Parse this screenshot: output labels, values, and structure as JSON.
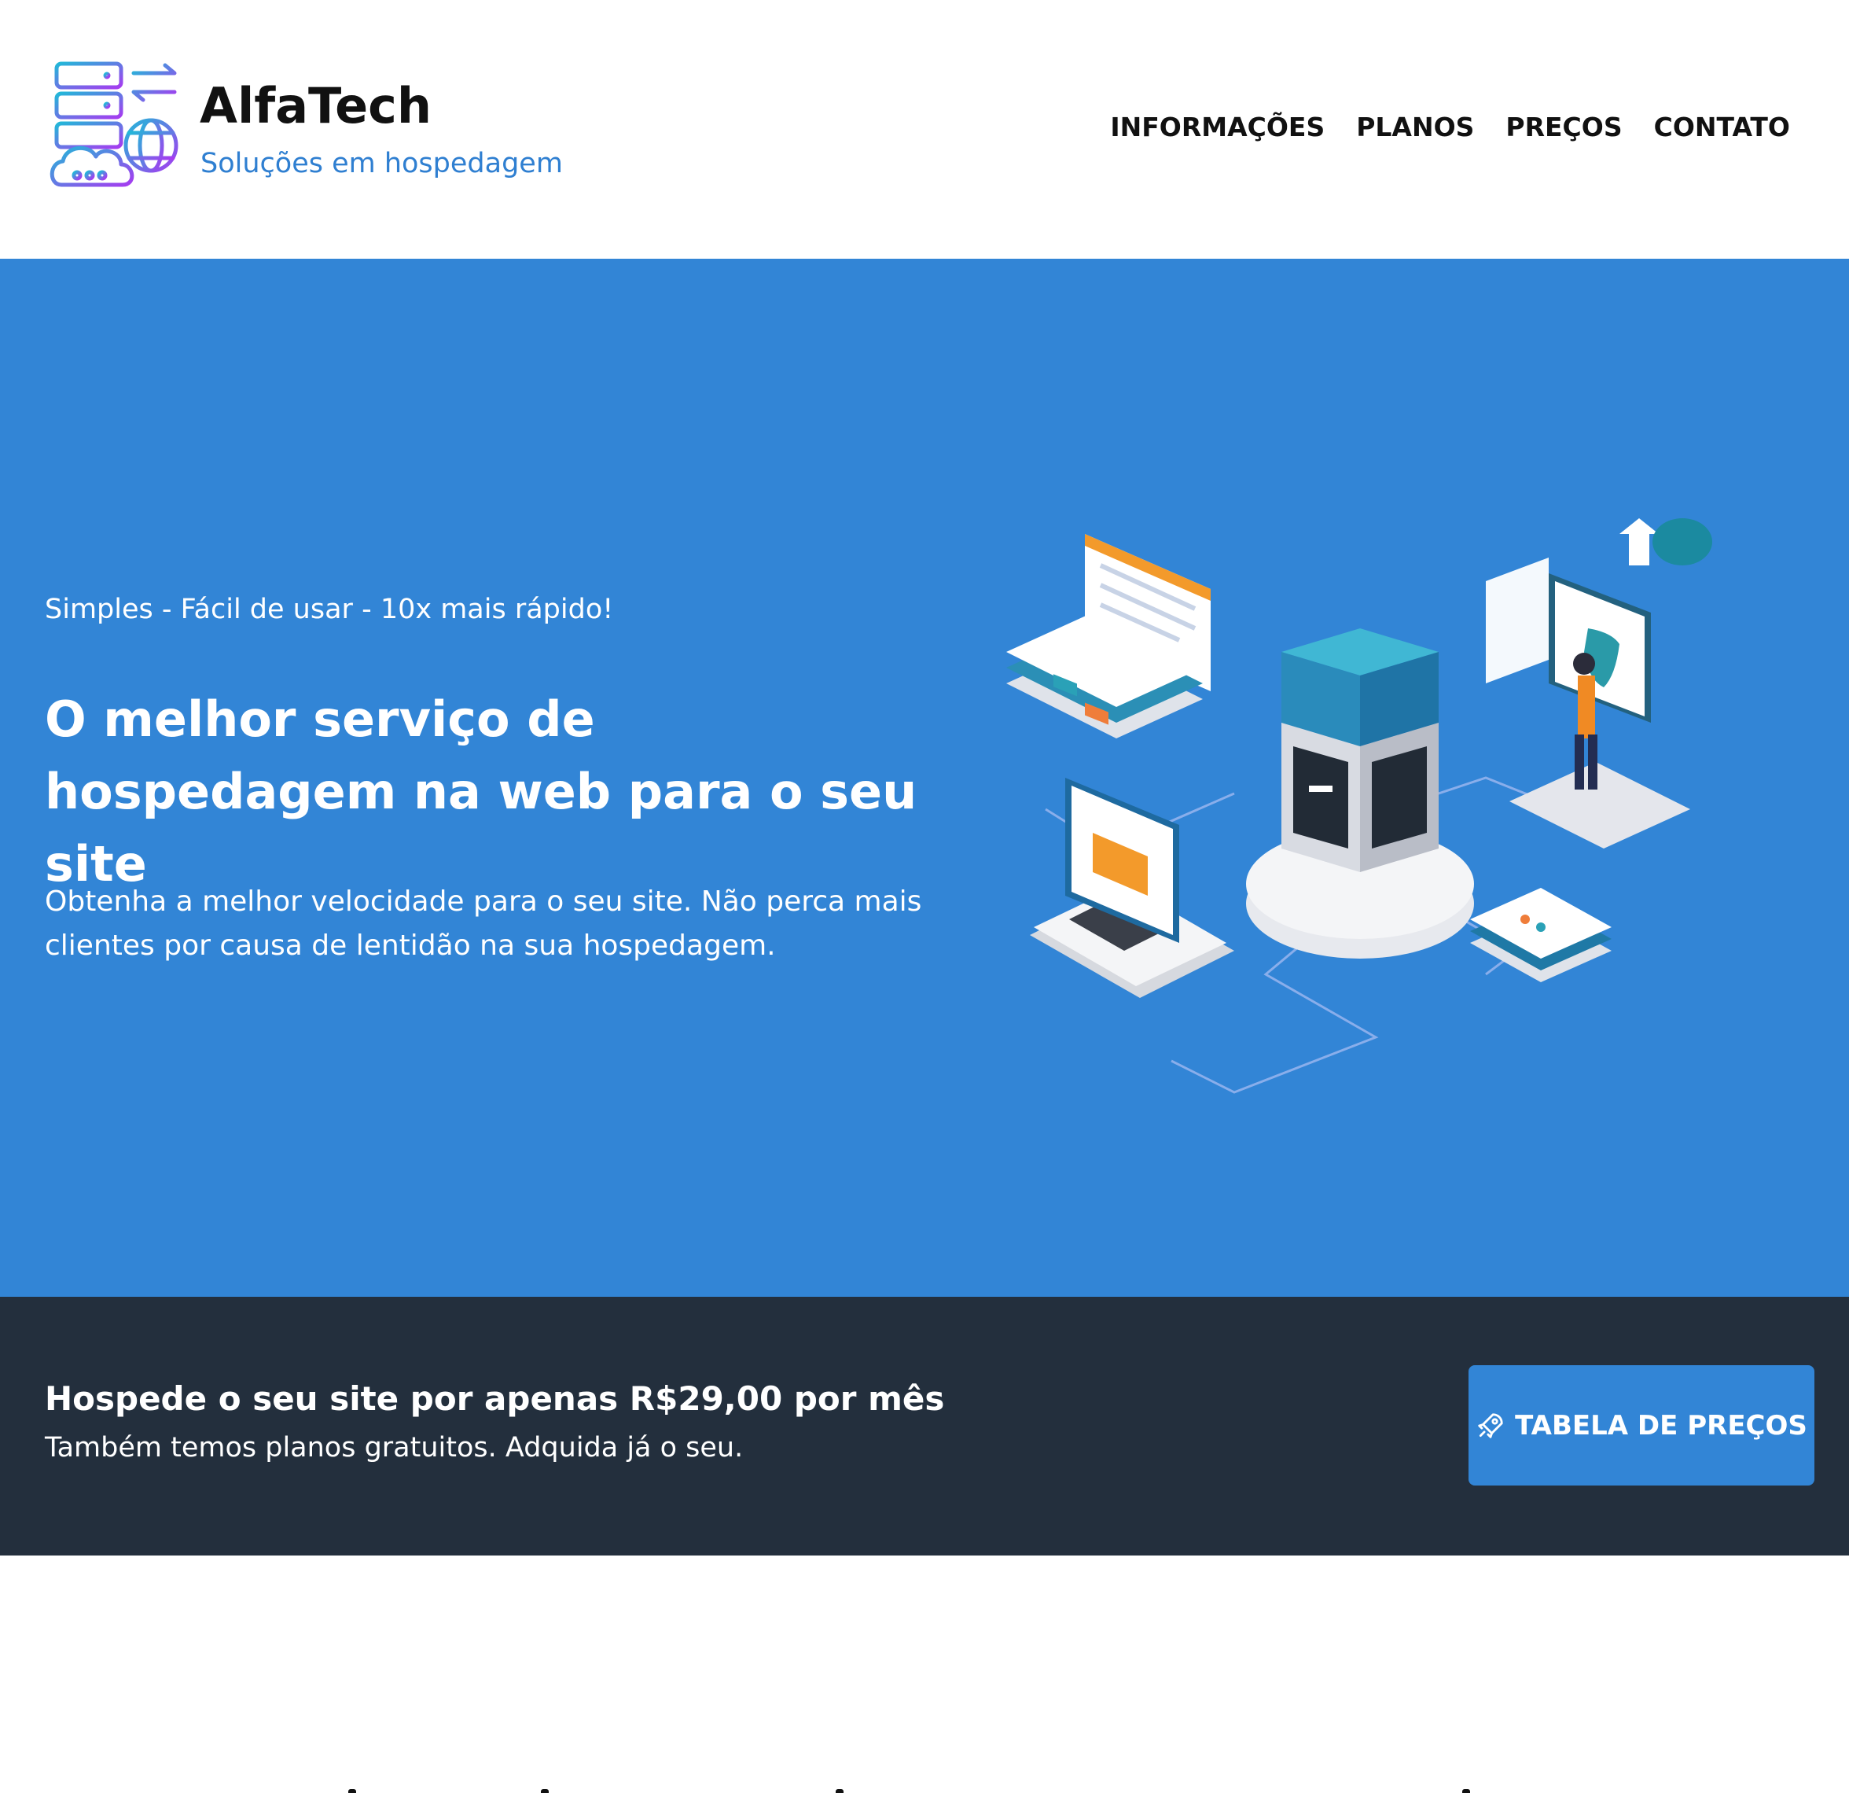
{
  "header": {
    "brand_title": "AlfaTech",
    "brand_subtitle": "Soluções em hospedagem",
    "nav": [
      "INFORMAÇÕES",
      "PLANOS",
      "PREÇOS",
      "CONTATO"
    ]
  },
  "hero": {
    "tagline": "Simples - Fácil de usar - 10x mais rápido!",
    "title": "O melhor serviço de hospedagem na web para o seu site",
    "text": "Obtenha a melhor velocidade para o seu site. Não perca mais clientes por causa de lentidão na sua hospedagem."
  },
  "cta": {
    "title": "Hospede o seu site por apenas R$29,00 por mês",
    "subtitle": "Também temos planos gratuitos. Adquida já o seu.",
    "button_label": "TABELA DE PREÇOS"
  },
  "colors": {
    "accent": "#3285d6",
    "dark_band": "#232f3d",
    "brand_subtitle": "#2f7fd1"
  },
  "icons": [
    "server-cloud-logo-icon",
    "rocket-icon"
  ]
}
